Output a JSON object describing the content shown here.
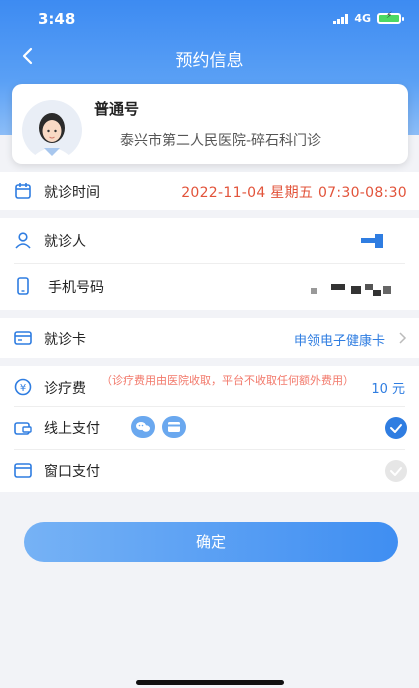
{
  "status_bar": {
    "time": "3:48",
    "network": "4G"
  },
  "nav": {
    "title": "预约信息"
  },
  "doctor_card": {
    "title": "普通号",
    "hospital": "泰兴市第二人民医院-碎石科门诊"
  },
  "visit_time": {
    "label": "就诊时间",
    "value": "2022-11-04 星期五 07:30-08:30"
  },
  "patient": {
    "label": "就诊人"
  },
  "phone": {
    "label": "手机号码"
  },
  "medical_card": {
    "label": "就诊卡",
    "value": "申领电子健康卡"
  },
  "fee": {
    "label": "诊疗费",
    "note": "（诊疗费用由医院收取，平台不收取任何额外费用）",
    "amount": "10 元"
  },
  "payment": {
    "online_label": "线上支付",
    "window_label": "窗口支付",
    "online_selected": true,
    "window_selected": false
  },
  "confirm": {
    "label": "确定"
  },
  "colors": {
    "accent": "#2f7de1",
    "highlight": "#e2533a",
    "note": "#f2786a"
  }
}
